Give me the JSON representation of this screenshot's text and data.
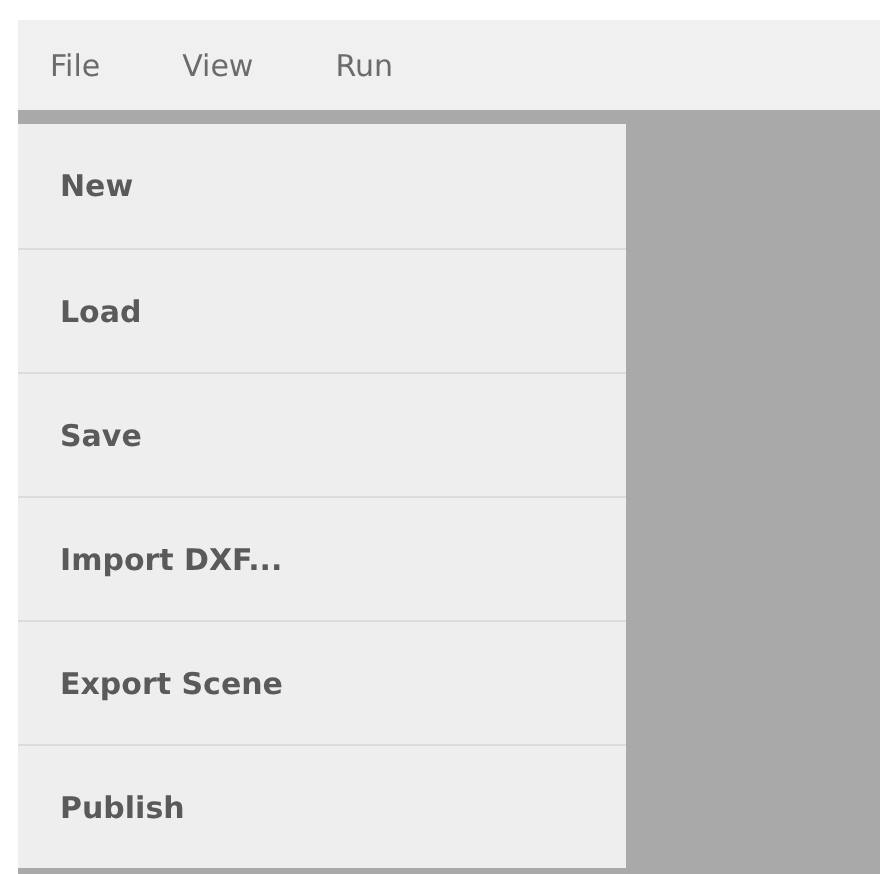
{
  "menubar": [
    {
      "label": "File"
    },
    {
      "label": "View"
    },
    {
      "label": "Run"
    }
  ],
  "file_menu": {
    "items": [
      {
        "label": "New"
      },
      {
        "label": "Load"
      },
      {
        "label": "Save"
      },
      {
        "label": "Import DXF..."
      },
      {
        "label": "Export Scene"
      },
      {
        "label": "Publish"
      }
    ]
  }
}
